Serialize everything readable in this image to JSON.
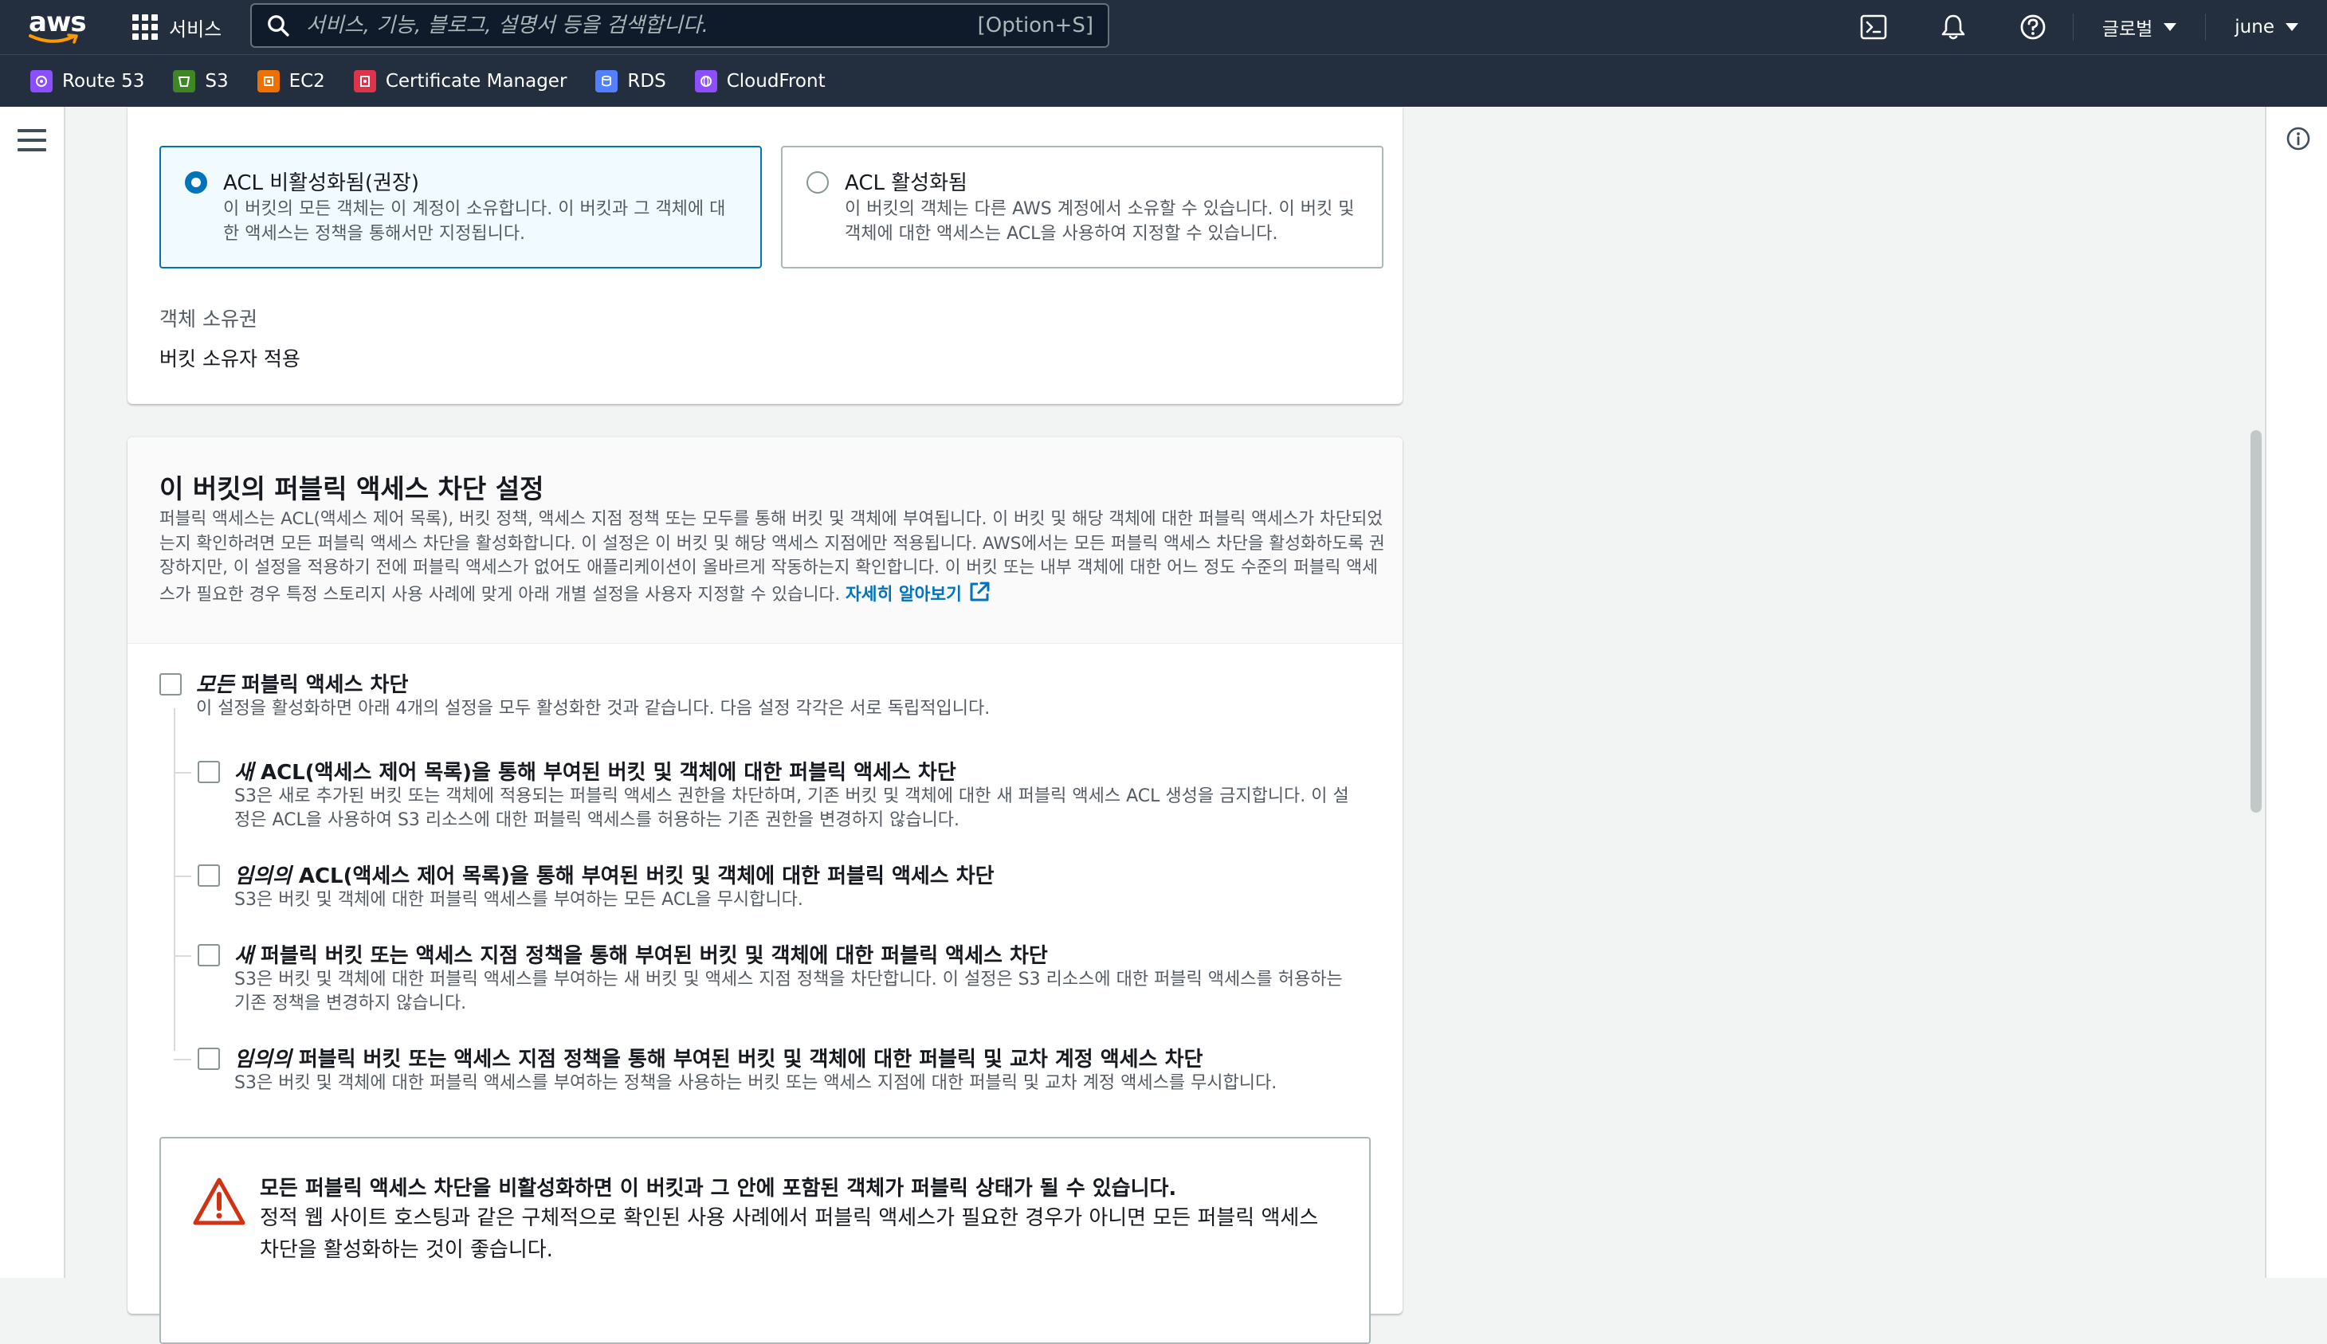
{
  "topnav": {
    "logo_text": "aws",
    "services_label": "서비스",
    "search_placeholder": "서비스, 기능, 블로그, 설명서 등을 검색합니다.",
    "search_shortcut": "[Option+S]",
    "region_label": "글로벌",
    "user_label": "june"
  },
  "favorites": [
    {
      "label": "Route 53",
      "color": "#8c4fff"
    },
    {
      "label": "S3",
      "color": "#3f8624"
    },
    {
      "label": "EC2",
      "color": "#ed7100"
    },
    {
      "label": "Certificate Manager",
      "color": "#dd344c"
    },
    {
      "label": "RDS",
      "color": "#527fff"
    },
    {
      "label": "CloudFront",
      "color": "#8c4fff"
    }
  ],
  "ownership": {
    "option_disabled": {
      "title": "ACL 비활성화됨(권장)",
      "desc": "이 버킷의 모든 객체는 이 계정이 소유합니다. 이 버킷과 그 객체에 대한 액세스는 정책을 통해서만 지정됩니다."
    },
    "option_enabled": {
      "title": "ACL 활성화됨",
      "desc": "이 버킷의 객체는 다른 AWS 계정에서 소유할 수 있습니다. 이 버킷 및 객체에 대한 액세스는 ACL을 사용하여 지정할 수 있습니다."
    },
    "field_label": "객체 소유권",
    "field_value": "버킷 소유자 적용"
  },
  "block_public": {
    "title": "이 버킷의 퍼블릭 액세스 차단 설정",
    "desc": "퍼블릭 액세스는 ACL(액세스 제어 목록), 버킷 정책, 액세스 지점 정책 또는 모두를 통해 버킷 및 객체에 부여됩니다. 이 버킷 및 해당 객체에 대한 퍼블릭 액세스가 차단되었는지 확인하려면 모든 퍼블릭 액세스 차단을 활성화합니다. 이 설정은 이 버킷 및 해당 액세스 지점에만 적용됩니다. AWS에서는 모든 퍼블릭 액세스 차단을 활성화하도록 권장하지만, 이 설정을 적용하기 전에 퍼블릭 액세스가 없어도 애플리케이션이 올바르게 작동하는지 확인합니다. 이 버킷 또는 내부 객체에 대한 어느 정도 수준의 퍼블릭 액세스가 필요한 경우 특정 스토리지 사용 사례에 맞게 아래 개별 설정을 사용자 지정할 수 있습니다.",
    "learn_more": "자세히 알아보기",
    "all": {
      "em": "모든",
      "rest": " 퍼블릭 액세스 차단",
      "desc": "이 설정을 활성화하면 아래 4개의 설정을 모두 활성화한 것과 같습니다. 다음 설정 각각은 서로 독립적입니다."
    },
    "options": [
      {
        "em": "새",
        "rest": " ACL(액세스 제어 목록)을 통해 부여된 버킷 및 객체에 대한 퍼블릭 액세스 차단",
        "desc": "S3은 새로 추가된 버킷 또는 객체에 적용되는 퍼블릭 액세스 권한을 차단하며, 기존 버킷 및 객체에 대한 새 퍼블릭 액세스 ACL 생성을 금지합니다. 이 설정은 ACL을 사용하여 S3 리소스에 대한 퍼블릭 액세스를 허용하는 기존 권한을 변경하지 않습니다."
      },
      {
        "em": "임의의",
        "rest": " ACL(액세스 제어 목록)을 통해 부여된 버킷 및 객체에 대한 퍼블릭 액세스 차단",
        "desc": "S3은 버킷 및 객체에 대한 퍼블릭 액세스를 부여하는 모든 ACL을 무시합니다."
      },
      {
        "em": "새",
        "rest": " 퍼블릭 버킷 또는 액세스 지점 정책을 통해 부여된 버킷 및 객체에 대한 퍼블릭 액세스 차단",
        "desc": "S3은 버킷 및 객체에 대한 퍼블릭 액세스를 부여하는 새 버킷 및 액세스 지점 정책을 차단합니다. 이 설정은 S3 리소스에 대한 퍼블릭 액세스를 허용하는 기존 정책을 변경하지 않습니다."
      },
      {
        "em": "임의의",
        "rest": " 퍼블릭 버킷 또는 액세스 지점 정책을 통해 부여된 버킷 및 객체에 대한 퍼블릭 및 교차 계정 액세스 차단",
        "desc": "S3은 버킷 및 객체에 대한 퍼블릭 액세스를 부여하는 정책을 사용하는 버킷 또는 액세스 지점에 대한 퍼블릭 및 교차 계정 액세스를 무시합니다."
      }
    ],
    "warning": {
      "title": "모든 퍼블릭 액세스 차단을 비활성화하면 이 버킷과 그 안에 포함된 객체가 퍼블릭 상태가 될 수 있습니다.",
      "body": "정적 웹 사이트 호스팅과 같은 구체적으로 확인된 사용 사례에서 퍼블릭 액세스가 필요한 경우가 아니면 모든 퍼블릭 액세스 차단을 활성화하는 것이 좋습니다."
    }
  }
}
